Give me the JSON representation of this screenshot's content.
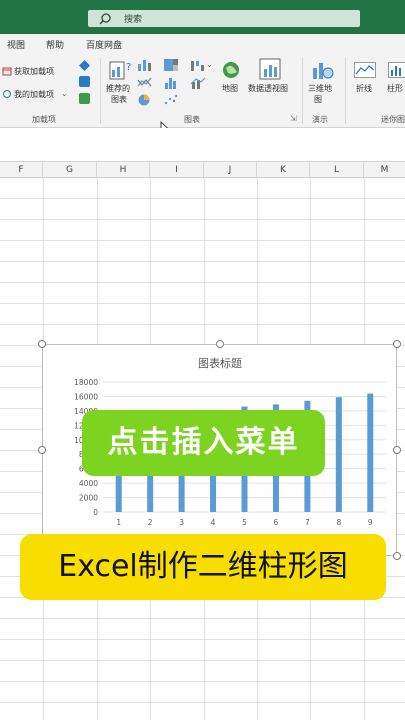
{
  "search": {
    "placeholder": "搜索",
    "icon": "search-icon"
  },
  "tabs": [
    "视图",
    "帮助",
    "百度网盘"
  ],
  "addins": {
    "get_label": "获取加载项",
    "my_label": "我的加载项",
    "group_label": "加载项"
  },
  "charts_group": {
    "recommended_line1": "推荐的",
    "recommended_line2": "图表",
    "map_label": "地图",
    "pivot_chart_label": "数据透视图",
    "group_label": "图表"
  },
  "demo_group": {
    "map3d_line1": "三维地",
    "map3d_line2": "图",
    "group_label": "演示"
  },
  "sparklines_group": {
    "line_label": "折线",
    "column_label": "柱形",
    "group_label": "迷你图"
  },
  "columns": [
    "F",
    "G",
    "H",
    "I",
    "J",
    "K",
    "L",
    "M"
  ],
  "chart_data": {
    "type": "bar",
    "title": "图表标题",
    "categories": [
      "1",
      "2",
      "3",
      "4",
      "5",
      "6",
      "7",
      "8",
      "9"
    ],
    "values": [
      10500,
      11200,
      11800,
      12600,
      14600,
      14900,
      15400,
      15900,
      16400
    ],
    "ylim": [
      0,
      18000
    ],
    "yticks": [
      0,
      2000,
      4000,
      6000,
      8000,
      10000,
      12000,
      14000,
      16000,
      18000
    ],
    "grid": true,
    "bar_color": "#5b9bd5"
  },
  "overlay": {
    "green_text": "点击插入菜单",
    "yellow_text": "Excel制作二维柱形图"
  },
  "colors": {
    "titlebar": "#217346",
    "accent_green": "#7ed321",
    "accent_yellow": "#f7dd00"
  }
}
